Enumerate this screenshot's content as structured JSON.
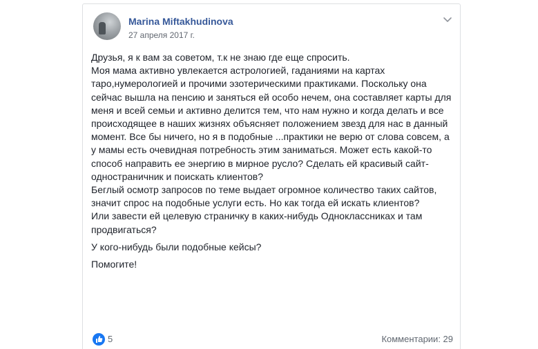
{
  "post": {
    "author": "Marina Miftakhudinova",
    "date": "27 апреля 2017 г.",
    "paragraphs": [
      "Друзья, я к вам за советом, т.к не знаю где еще спросить.\nМоя мама активно увлекается астрологией, гаданиями на картах таро,нумерологией и прочими эзотерическими практиками. Поскольку она сейчас вышла на пенсию и заняться ей особо нечем, она составляет карты для меня и всей семьи и активно делится тем, что нам нужно и когда делать и все происходящее в наших жизнях объясняет положением звезд для нас в данный момент. Все бы ничего, но я в подобные ...практики не верю от слова совсем, а у мамы есть очевидная потребность этим заниматься. Может есть какой-то способ направить ее энергию в мирное русло? Сделать ей красивый сайт-одностраничник и поискать клиентов?\nБеглый осмотр запросов по теме выдает огромное количество таких сайтов, значит спрос на подобные услуги есть. Но как тогда ей искать клиентов?\nИли завести ей целевую страничку в каких-нибудь Одноклассниках и там продвигаться?",
      "У кого-нибудь были подобные кейсы?",
      "Помогите!"
    ],
    "likes": "5",
    "comments": "Комментарии: 29"
  },
  "icons": {
    "menu": "chevron-down-icon",
    "like": "thumbs-up-icon"
  },
  "colors": {
    "author_link": "#365899",
    "like_badge": "#1877f2",
    "text": "#1d2129",
    "meta": "#616770"
  }
}
